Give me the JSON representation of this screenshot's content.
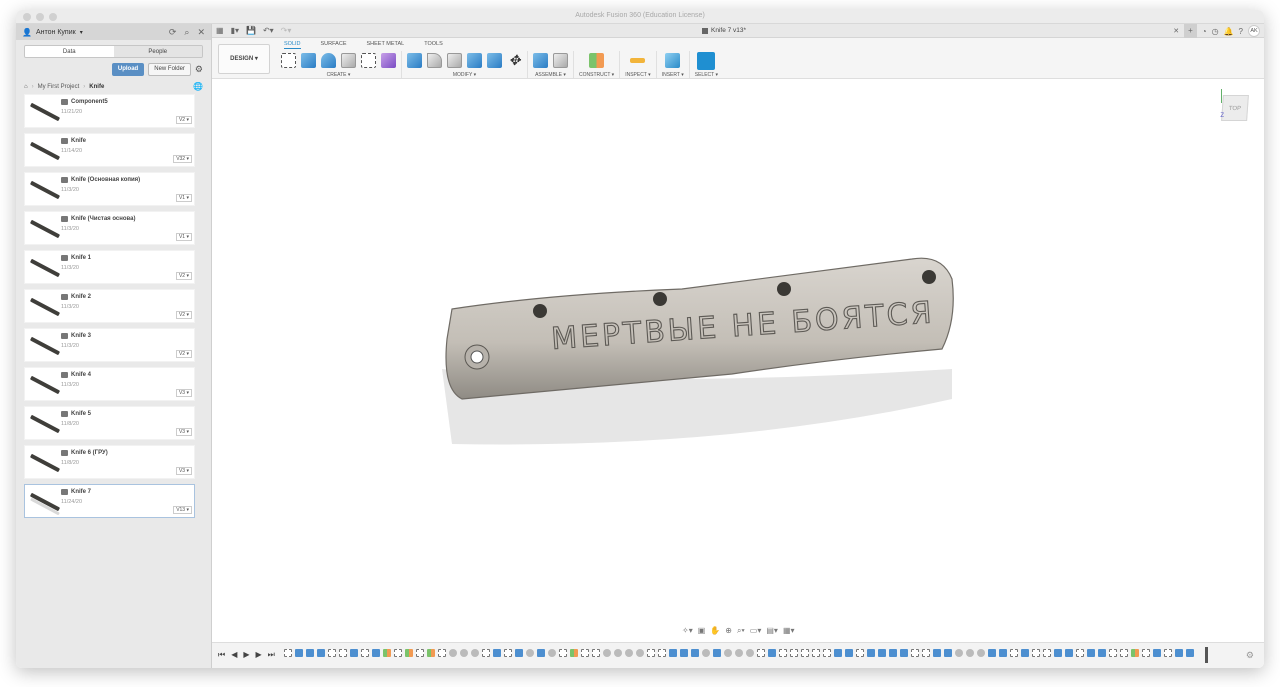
{
  "window": {
    "title": "Autodesk Fusion 360 (Education License)"
  },
  "panel": {
    "user": "Антон Купик",
    "tabs": [
      {
        "label": "Data",
        "active": true
      },
      {
        "label": "People",
        "active": false
      }
    ],
    "upload_label": "Upload",
    "new_folder_label": "New Folder",
    "breadcrumb": [
      "My First Project",
      "Knife"
    ],
    "items": [
      {
        "name": "Component5",
        "date": "11/21/20",
        "version": "V2"
      },
      {
        "name": "Knife",
        "date": "11/14/20",
        "version": "V32"
      },
      {
        "name": "Knife (Основная копия)",
        "date": "11/3/20",
        "version": "V1"
      },
      {
        "name": "Knife (Чистая основа)",
        "date": "11/3/20",
        "version": "V1"
      },
      {
        "name": "Knife 1",
        "date": "11/3/20",
        "version": "V2"
      },
      {
        "name": "Knife 2",
        "date": "11/3/20",
        "version": "V2"
      },
      {
        "name": "Knife 3",
        "date": "11/3/20",
        "version": "V2"
      },
      {
        "name": "Knife 4",
        "date": "11/3/20",
        "version": "V3"
      },
      {
        "name": "Knife 5",
        "date": "11/8/20",
        "version": "V3"
      },
      {
        "name": "Knife 6 (ГРУ)",
        "date": "11/8/20",
        "version": "V3"
      },
      {
        "name": "Knife 7",
        "date": "11/24/20",
        "version": "V13",
        "selected": true
      }
    ]
  },
  "document": {
    "tab_title": "Knife 7 v13*",
    "user_initials": "AK"
  },
  "ribbon": {
    "workspace": "DESIGN ▾",
    "tabs": [
      {
        "label": "SOLID",
        "active": true
      },
      {
        "label": "SURFACE"
      },
      {
        "label": "SHEET METAL"
      },
      {
        "label": "TOOLS"
      }
    ],
    "groups": [
      "CREATE ▾",
      "MODIFY ▾",
      "ASSEMBLE ▾",
      "CONSTRUCT ▾",
      "INSPECT ▾",
      "INSERT ▾",
      "SELECT ▾"
    ]
  },
  "viewport": {
    "viewcube_face": "TOP",
    "axis_z": "Z",
    "engraving": "МЕРТВЫЕ НЕ БОЯТСЯ"
  }
}
